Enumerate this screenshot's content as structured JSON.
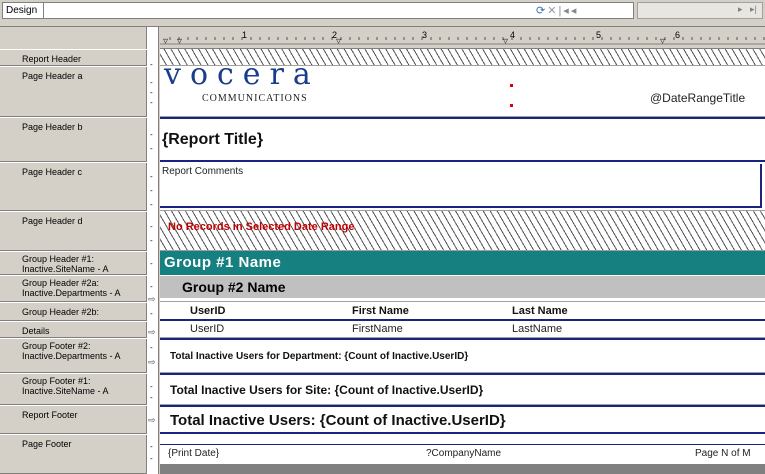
{
  "toolbar": {
    "tab_design": "Design",
    "icons": [
      "refresh-icon",
      "close-icon",
      "first-page-icon",
      "prev-page-icon",
      "next-page-icon",
      "last-page-icon"
    ]
  },
  "ruler": {
    "numbers": [
      "1",
      "2",
      "3",
      "4",
      "5",
      "6"
    ]
  },
  "bands": [
    {
      "label": "Report Header"
    },
    {
      "label": "Page Header a"
    },
    {
      "label": "Page Header b"
    },
    {
      "label": "Page Header c"
    },
    {
      "label": "Page Header d"
    },
    {
      "label": "Group Header #1: Inactive.SiteName - A"
    },
    {
      "label": "Group Header #2a: Inactive.Departments - A"
    },
    {
      "label": "Group Header #2b:"
    },
    {
      "label": "Details"
    },
    {
      "label": "Group Footer #2: Inactive.Departments - A"
    },
    {
      "label": "Group Footer #1: Inactive.SiteName - A"
    },
    {
      "label": "Report Footer"
    },
    {
      "label": "Page Footer"
    }
  ],
  "content": {
    "logo_text": "vocera",
    "logo_sub": "COMMUNICATIONS",
    "date_range_title": "@DateRangeTitle",
    "report_title": "{Report Title}",
    "report_comments": "Report Comments",
    "no_records": "No Records in Selected Date Range",
    "group1_name": "Group #1 Name",
    "group2_name": "Group #2 Name",
    "col_userid": "UserID",
    "col_firstname": "First Name",
    "col_lastname": "Last Name",
    "det_userid": "UserID",
    "det_firstname": "FirstName",
    "det_lastname": "LastName",
    "gf2_text": "Total Inactive Users for Department:  {Count of Inactive.UserID}",
    "gf1_text": "Total Inactive Users for Site:  {Count of Inactive.UserID}",
    "rf_text": "Total Inactive Users:  {Count of Inactive.UserID}",
    "pf_print_date": "{Print Date}",
    "pf_company": "?CompanyName",
    "pf_page": "Page N of M"
  },
  "colors": {
    "group1_bg": "#167f7f",
    "group2_bg": "#c0c0c0",
    "navy": "#1a237e",
    "no_records": "#c00000"
  }
}
